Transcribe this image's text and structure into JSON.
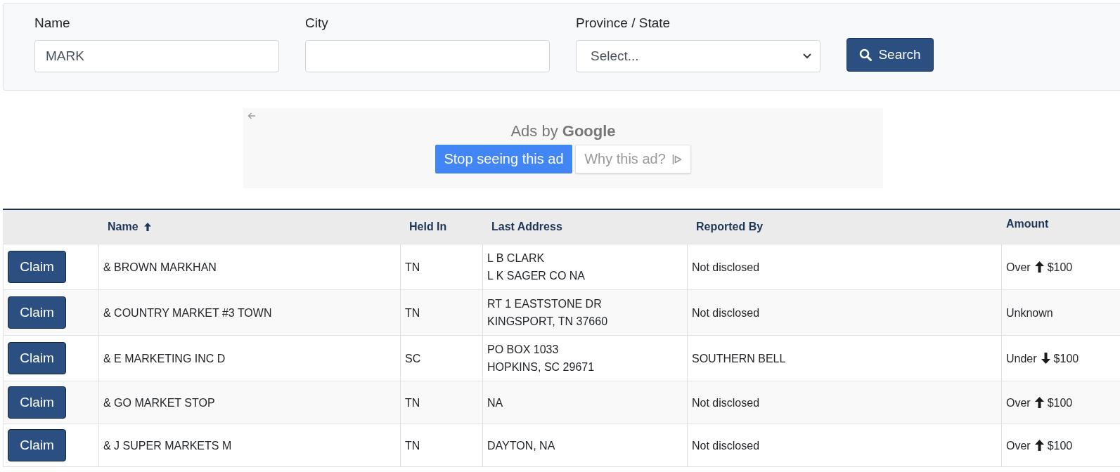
{
  "search_form": {
    "fields": [
      {
        "kind": "text",
        "label": "Name",
        "value": "MARK"
      },
      {
        "kind": "text",
        "label": "City"
      },
      {
        "kind": "select",
        "label": "Province / State",
        "placeholder": "Select..."
      }
    ],
    "button": "Search"
  },
  "ad": {
    "attribution": "Ads by **Google**",
    "buttons": [
      {
        "kind": "primary",
        "label": "Stop seeing this ad"
      },
      {
        "kind": "info",
        "label": "Why this ad?"
      }
    ]
  },
  "table": {
    "columns": [
      {
        "label": "Name",
        "sorted": true
      },
      {
        "label": "Held In",
        "sorted": false
      },
      {
        "label": "Last Address",
        "sorted": false
      },
      {
        "label": "Reported By",
        "sorted": false
      },
      {
        "label": "Amount",
        "sorted": false
      }
    ],
    "rows": [
      {
        "action": "Claim",
        "name": "& BROWN MARKHAN",
        "held_in": "TN",
        "last_address": [
          "L B CLARK",
          "L K SAGER CO NA"
        ],
        "reported_by": "Not disclosed",
        "amount": {
          "kind": "over",
          "label": "Over",
          "value": "$100"
        }
      },
      {
        "action": "Claim",
        "name": "& COUNTRY MARKET #3 TOWN",
        "held_in": "TN",
        "last_address": [
          "RT 1 EASTSTONE DR",
          "KINGSPORT, TN 37660"
        ],
        "reported_by": "Not disclosed",
        "amount": {
          "kind": "unknown",
          "label": "Unknown"
        }
      },
      {
        "action": "Claim",
        "name": "& E MARKETING INC D",
        "held_in": "SC",
        "last_address": [
          "PO BOX 1033",
          "HOPKINS, SC 29671"
        ],
        "reported_by": "SOUTHERN BELL",
        "amount": {
          "kind": "under",
          "label": "Under",
          "value": "$100"
        }
      },
      {
        "action": "Claim",
        "name": "& GO MARKET STOP",
        "held_in": "TN",
        "last_address": [
          "NA"
        ],
        "reported_by": "Not disclosed",
        "amount": {
          "kind": "over",
          "label": "Over",
          "value": "$100"
        }
      },
      {
        "action": "Claim",
        "name": "& J SUPER MARKETS M",
        "held_in": "TN",
        "last_address": [
          "DAYTON, NA"
        ],
        "reported_by": "Not disclosed",
        "amount": {
          "kind": "over",
          "label": "Over",
          "value": "$100"
        }
      }
    ]
  }
}
